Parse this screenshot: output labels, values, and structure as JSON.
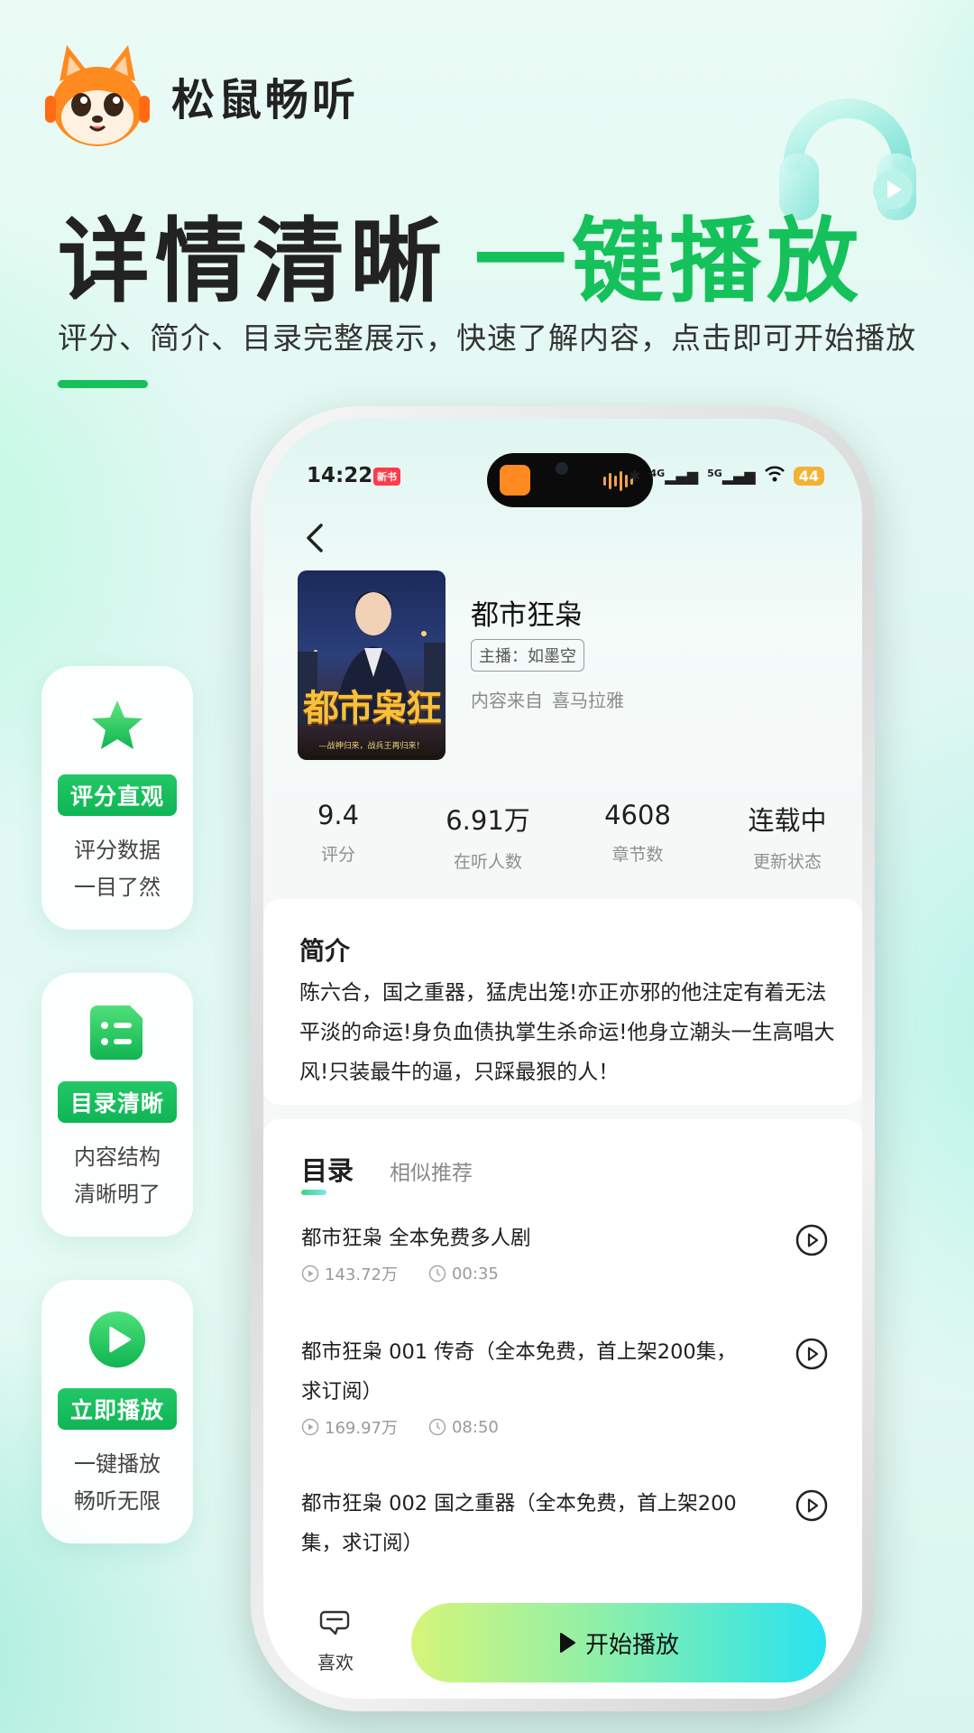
{
  "brand": {
    "name": "松鼠畅听"
  },
  "headline": {
    "part1": "详情清晰",
    "part2": "一键播放"
  },
  "subline": "评分、简介、目录完整展示，快速了解内容，点击即可开始播放",
  "features": [
    {
      "icon": "star-icon",
      "tag": "评分直观",
      "desc1": "评分数据",
      "desc2": "一目了然"
    },
    {
      "icon": "catalog-icon",
      "tag": "目录清晰",
      "desc1": "内容结构",
      "desc2": "清晰明了"
    },
    {
      "icon": "play-circle-icon",
      "tag": "立即播放",
      "desc1": "一键播放",
      "desc2": "畅听无限"
    }
  ],
  "colors": {
    "accent": "#15c15a",
    "tag_bg": "#18c05d",
    "battery": "#f2b233"
  },
  "phone": {
    "status": {
      "time": "14:22",
      "badge": "新书",
      "signal1": "4G",
      "signal2": "5G",
      "battery": "44"
    },
    "book": {
      "cover_title": "都市枭狂",
      "cover_subtitle": "—战神归来，战兵王再归来！",
      "title": "都市狂枭",
      "anchor": "主播：如墨空",
      "source_label": "内容来自",
      "source_name": "喜马拉雅"
    },
    "stats": [
      {
        "value": "9.4",
        "label": "评分"
      },
      {
        "value": "6.91万",
        "label": "在听人数"
      },
      {
        "value": "4608",
        "label": "章节数"
      },
      {
        "value": "连载中",
        "label": "更新状态"
      }
    ],
    "intro": {
      "heading": "简介",
      "text": "陈六合，国之重器，猛虎出笼!亦正亦邪的他注定有着无法平淡的命运!身负血债执掌生杀命运!他身立潮头一生高唱大风!只装最牛的逼，只踩最狠的人！"
    },
    "tabs": {
      "active": "目录",
      "other": "相似推荐"
    },
    "episodes": [
      {
        "title": "都市狂枭 全本免费多人剧",
        "plays": "143.72万",
        "duration": "00:35"
      },
      {
        "title": "都市狂枭 001 传奇（全本免费，首上架200集，求订阅）",
        "plays": "169.97万",
        "duration": "08:50"
      },
      {
        "title": "都市狂枭 002 国之重器（全本免费，首上架200集，求订阅）",
        "plays": "",
        "duration": ""
      }
    ],
    "bottom": {
      "like": "喜欢",
      "start": "开始播放"
    }
  }
}
